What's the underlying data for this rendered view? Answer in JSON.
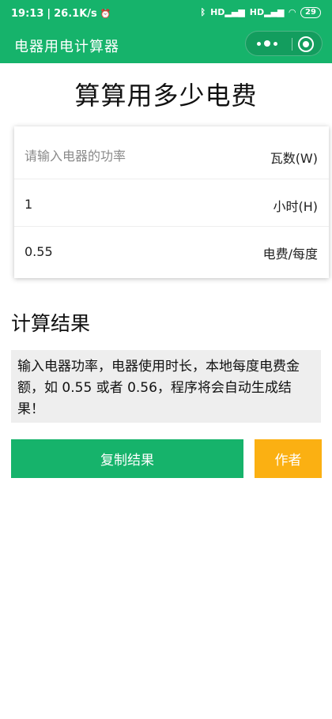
{
  "status_bar": {
    "time": "19:13",
    "network_speed": "26.1K/s",
    "alarm_icon": "alarm-icon",
    "bluetooth_icon": "bluetooth-icon",
    "signal1": "HD",
    "signal2": "HD",
    "wifi_icon": "wifi-icon",
    "battery": "29"
  },
  "navbar": {
    "title": "电器用电计算器"
  },
  "heading": "算算用多少电费",
  "inputs": [
    {
      "value": "",
      "placeholder": "请输入电器的功率",
      "unit": "瓦数(W)"
    },
    {
      "value": "1",
      "placeholder": "",
      "unit": "小时(H)"
    },
    {
      "value": "0.55",
      "placeholder": "",
      "unit": "电费/每度"
    }
  ],
  "result": {
    "title": "计算结果",
    "text": "输入电器功率，电器使用时长，本地每度电费金额，如 0.55 或者 0.56，程序将会自动生成结果！"
  },
  "buttons": {
    "copy": "复制结果",
    "author": "作者"
  },
  "colors": {
    "brand": "#16b36b",
    "accent": "#fbb012"
  }
}
